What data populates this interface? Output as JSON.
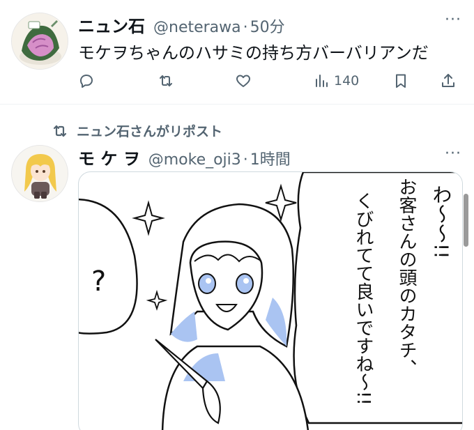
{
  "tweets": [
    {
      "display_name": "ニュン石",
      "handle": "@neterawa",
      "separator": "·",
      "time": "50分",
      "text": "モケヲちゃんのハサミの持ち方バーバリアンだ",
      "more": "···",
      "actions": {
        "reply_icon": "reply-icon",
        "repost_icon": "repost-icon",
        "like_icon": "heart-icon",
        "views_icon": "views-icon",
        "views_count": "140",
        "bookmark_icon": "bookmark-icon",
        "share_icon": "share-icon"
      }
    },
    {
      "repost_label": "ニュン石さんがリポスト",
      "display_name": "モ ケ ヲ",
      "handle": "@moke_oji3",
      "separator": "·",
      "time": "1時間",
      "more": "···",
      "manga": {
        "vertical_text": [
          "わ〜〜!!",
          "お客さんの頭のカタチ、",
          "くびれてて良いですね〜!!"
        ],
        "question_mark": "?"
      }
    }
  ],
  "colors": {
    "text": "#0f1419",
    "secondary": "#536471",
    "divider": "#eff3f4",
    "manga_accent": "#aac4f2"
  }
}
